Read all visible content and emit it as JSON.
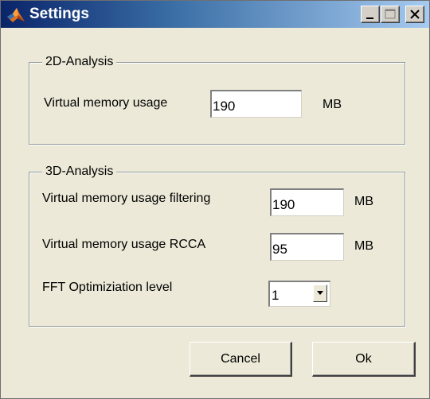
{
  "window": {
    "title": "Settings"
  },
  "section_2d": {
    "legend": "2D-Analysis",
    "vm_label": "Virtual memory usage",
    "vm_value": "190",
    "vm_unit": "MB"
  },
  "section_3d": {
    "legend": "3D-Analysis",
    "vm_filter_label": "Virtual memory usage filtering",
    "vm_filter_value": "190",
    "vm_filter_unit": "MB",
    "vm_rcca_label": "Virtual memory usage RCCA",
    "vm_rcca_value": "95",
    "vm_rcca_unit": "MB",
    "fft_label": "FFT Optimiziation level",
    "fft_value": "1"
  },
  "buttons": {
    "cancel": "Cancel",
    "ok": "Ok"
  },
  "icons": {
    "app": "matlab-icon",
    "minimize": "minimize-icon",
    "maximize": "maximize-icon",
    "close": "close-icon",
    "dropdown": "chevron-down-icon"
  },
  "colors": {
    "titlebar_start": "#0a246a",
    "titlebar_end": "#a6caf0",
    "dialog_bg": "#ece9d8",
    "field_bg": "#ffffff"
  }
}
